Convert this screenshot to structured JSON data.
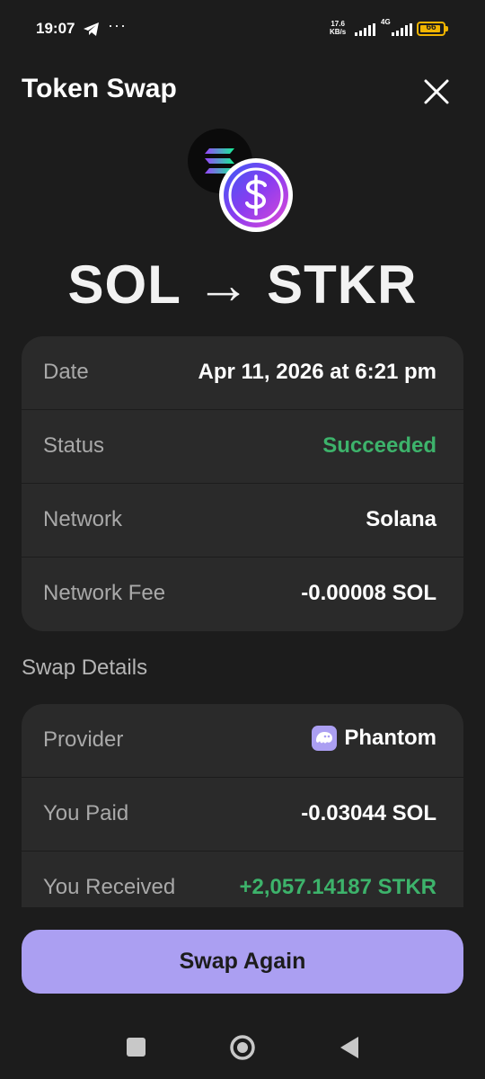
{
  "status_bar": {
    "time": "19:07",
    "net_speed_value": "17.6",
    "net_speed_unit": "KB/s",
    "network_type": "4G",
    "battery": "66",
    "battery_color": "#f0b400"
  },
  "header": {
    "title": "Token Swap"
  },
  "swap": {
    "pair": "SOL → STKR",
    "from_token_icon": "solana-icon",
    "to_token_icon": "stkr-dollar-icon"
  },
  "details": [
    {
      "label": "Date",
      "value": "Apr 11, 2026 at 6:21 pm"
    },
    {
      "label": "Status",
      "value": "Succeeded"
    },
    {
      "label": "Network",
      "value": "Solana"
    },
    {
      "label": "Network Fee",
      "value": "-0.00008 SOL"
    }
  ],
  "swap_details": {
    "section_title": "Swap Details",
    "provider_label": "Provider",
    "provider_name": "Phantom",
    "paid_label": "You Paid",
    "paid_value": "-0.03044 SOL",
    "received_label": "You Received",
    "received_value": "+2,057.14187 STKR"
  },
  "actions": {
    "swap_again": "Swap Again"
  },
  "colors": {
    "background": "#1c1c1c",
    "card": "#2a2a2a",
    "success": "#3db36b",
    "accent": "#ab9ff2"
  }
}
